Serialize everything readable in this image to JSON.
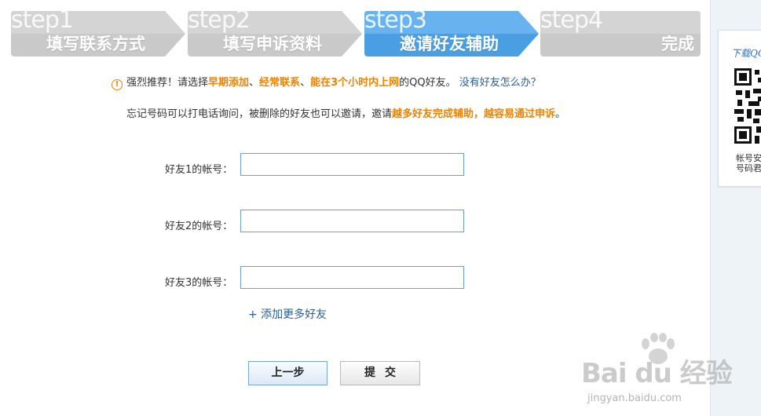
{
  "steps": [
    {
      "word": "step1",
      "title": "填写联系方式",
      "state": "inactive"
    },
    {
      "word": "step2",
      "title": "填写申诉资料",
      "state": "inactive"
    },
    {
      "word": "step3",
      "title": "邀请好友辅助",
      "state": "active"
    },
    {
      "word": "step4",
      "title": "完成",
      "state": "inactive"
    }
  ],
  "notice": {
    "icon": "warning-circle-icon",
    "line1": {
      "p1": "强烈推荐！请选择",
      "hl1": "早期添加",
      "sep1": "、",
      "hl2": "经常联系",
      "sep2": "、",
      "hl3": "能在3个小时内上网",
      "p2": "的QQ好友。",
      "link": "没有好友怎么办？"
    },
    "line2": {
      "p1": "忘记号码可以打电话询问，被删除的好友也可以邀请，邀请",
      "hl": "越多好友完成辅助，越容易通过申诉",
      "p2": "。"
    }
  },
  "form": {
    "friends": [
      {
        "label": "好友1的帐号：",
        "value": ""
      },
      {
        "label": "好友2的帐号：",
        "value": ""
      },
      {
        "label": "好友3的帐号：",
        "value": ""
      }
    ],
    "add_more": "+ 添加更多好友",
    "prev_button": "上一步",
    "submit_button": "提交"
  },
  "sidebar": {
    "download_label": "下载QQ",
    "caption_line1": "帐号安",
    "caption_line2": "号码君"
  },
  "watermark": {
    "brand": "Bai du 经验",
    "url": "jingyan.baidu.com"
  },
  "colors": {
    "active_step": "#4da3e6",
    "inactive_step": "#c9c9c9",
    "highlight": "#f08300",
    "link": "#2b5e9a"
  }
}
